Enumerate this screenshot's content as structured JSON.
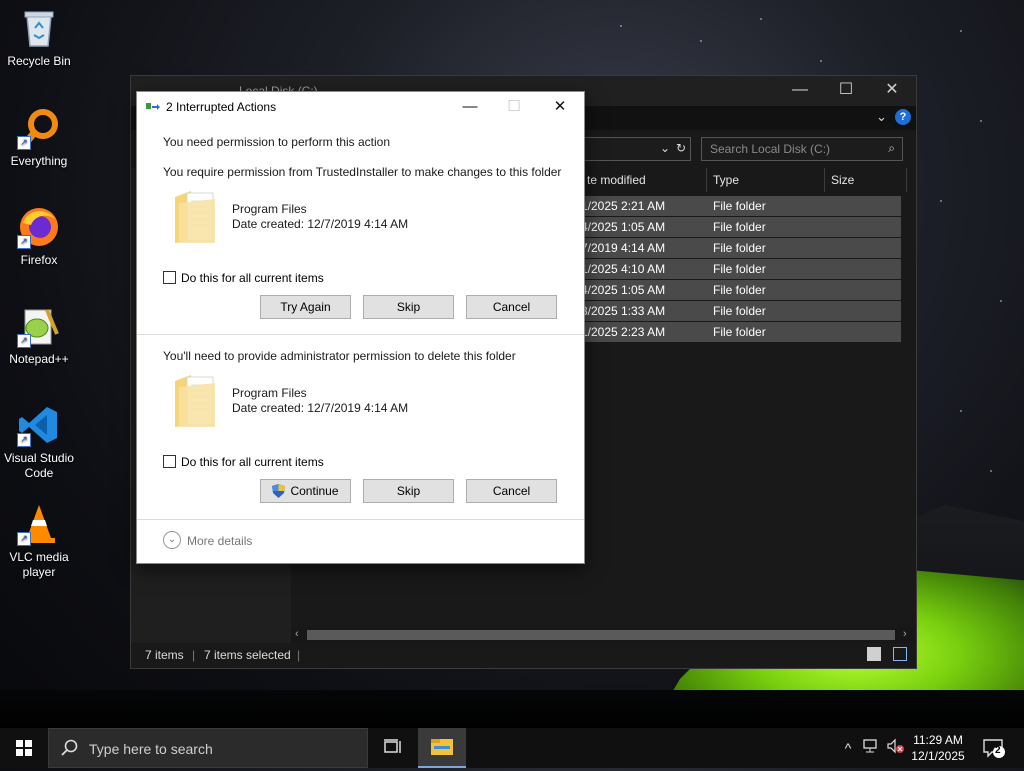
{
  "desktop": {
    "icons": [
      {
        "label": "Recycle Bin"
      },
      {
        "label": "Everything"
      },
      {
        "label": "Firefox"
      },
      {
        "label": "Notepad++"
      },
      {
        "label": "Visual Studio Code"
      },
      {
        "label": "VLC media player"
      }
    ]
  },
  "explorer": {
    "title": "Local Disk (C:)",
    "search_placeholder": "Search Local Disk (C:)",
    "columns": {
      "date": "te modified",
      "type": "Type",
      "size": "Size"
    },
    "rows": [
      {
        "date": "1/2025 2:21 AM",
        "type": "File folder"
      },
      {
        "date": "4/2025 1:05 AM",
        "type": "File folder"
      },
      {
        "date": "7/2019 4:14 AM",
        "type": "File folder"
      },
      {
        "date": "1/2025 4:10 AM",
        "type": "File folder"
      },
      {
        "date": "4/2025 1:05 AM",
        "type": "File folder"
      },
      {
        "date": "3/2025 1:33 AM",
        "type": "File folder"
      },
      {
        "date": "1/2025 2:23 AM",
        "type": "File folder"
      }
    ],
    "status": {
      "items": "7 items",
      "selected": "7 items selected"
    }
  },
  "dialog": {
    "title": "2 Interrupted Actions",
    "section1": {
      "heading": "You need permission to perform this action",
      "message": "You require permission from TrustedInstaller to make changes to this folder",
      "folder_name": "Program Files",
      "folder_date": "Date created: 12/7/2019 4:14 AM",
      "checkbox": "Do this for all current items",
      "buttons": {
        "try_again": "Try Again",
        "skip": "Skip",
        "cancel": "Cancel"
      }
    },
    "section2": {
      "message": "You'll need to provide administrator permission to delete this folder",
      "folder_name": "Program Files",
      "folder_date": "Date created: 12/7/2019 4:14 AM",
      "checkbox": "Do this for all current items",
      "buttons": {
        "continue": "Continue",
        "skip": "Skip",
        "cancel": "Cancel"
      }
    },
    "more_details": "More details"
  },
  "taskbar": {
    "search_placeholder": "Type here to search",
    "time": "11:29 AM",
    "date": "12/1/2025",
    "notification_count": "2"
  },
  "colors": {
    "accent": "#1f6ed6",
    "selection": "#4a4a4a",
    "tent_green": "#7ad10f"
  }
}
